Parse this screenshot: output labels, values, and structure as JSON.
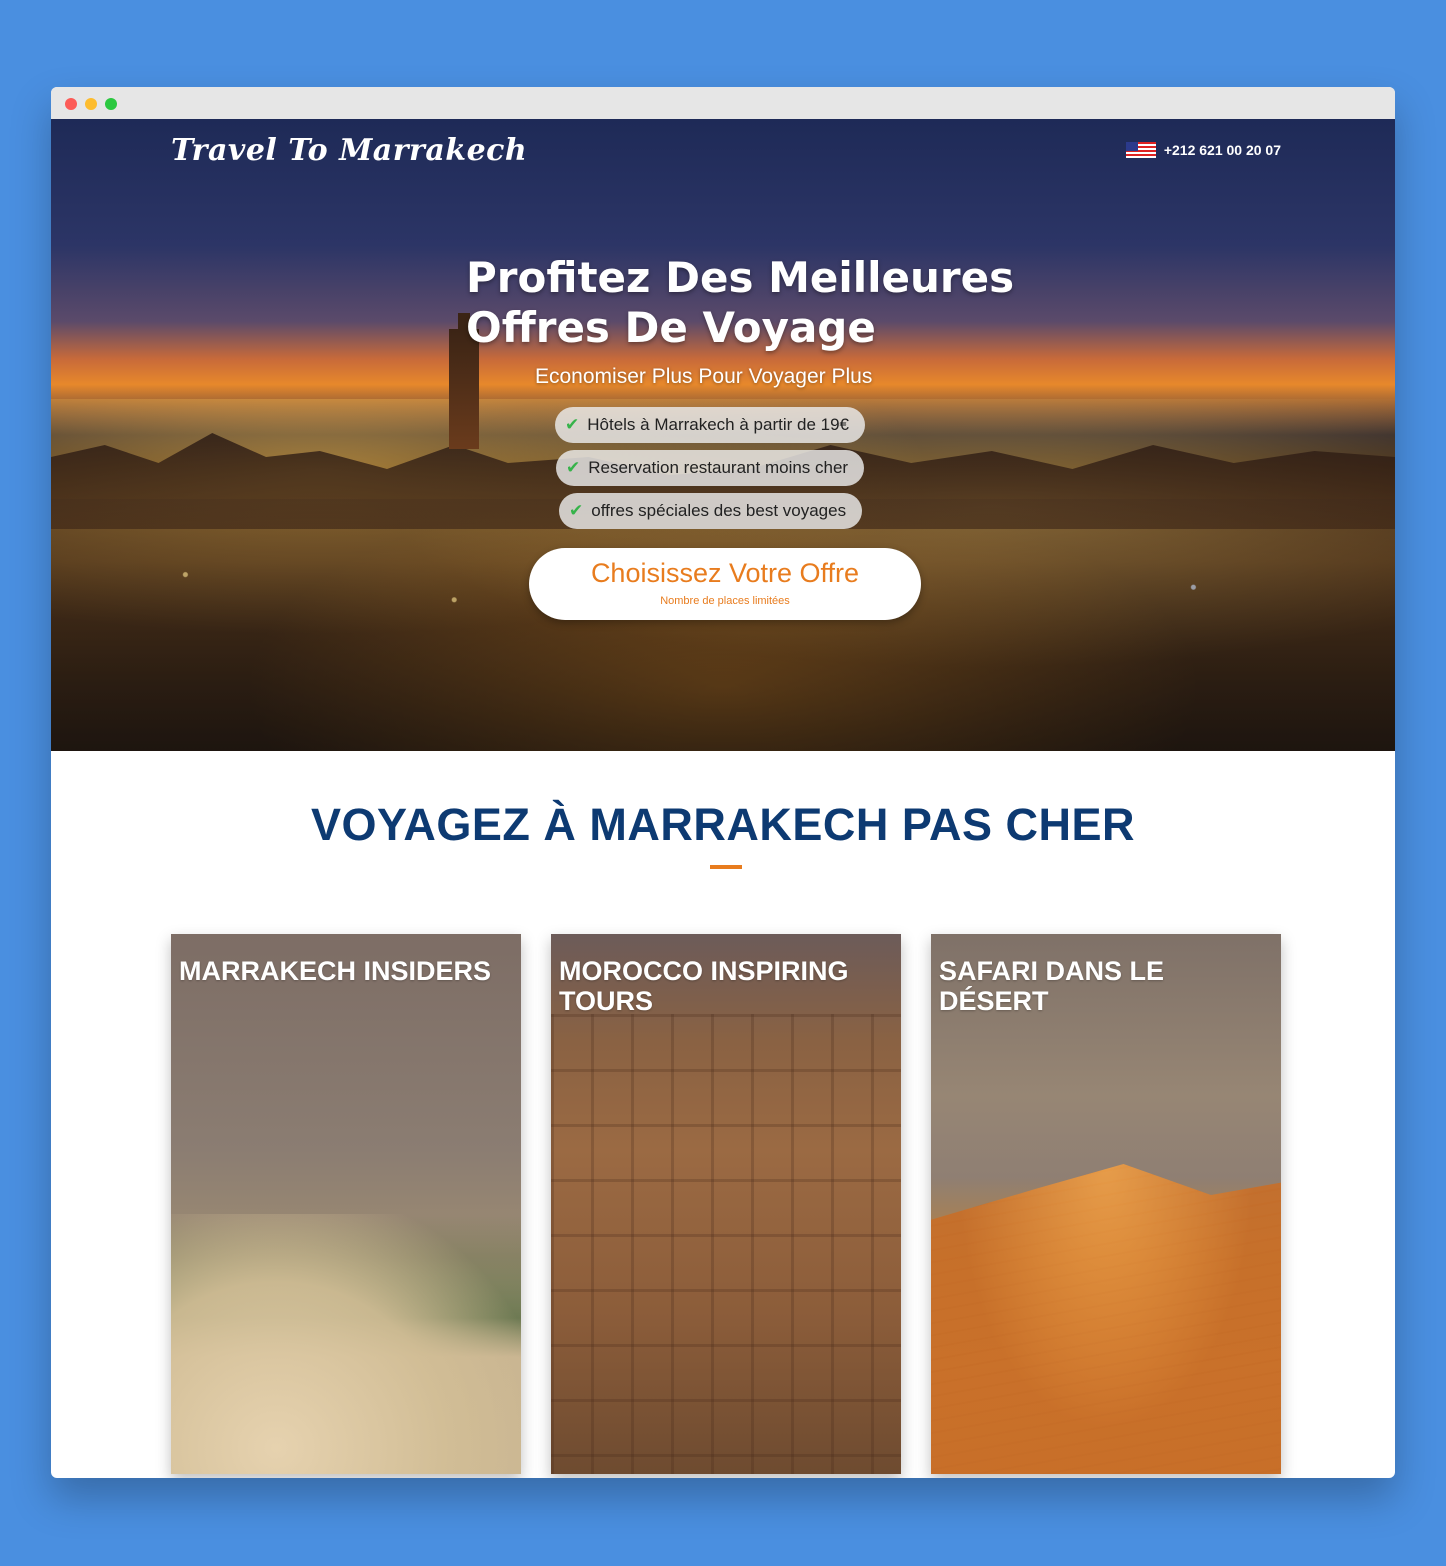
{
  "header": {
    "logo": "Travel To Marrakech",
    "phone": "+212 621 00 20 07"
  },
  "hero": {
    "title_line1": "Profitez Des Meilleures",
    "title_line2": "Offres De Voyage",
    "subtitle": "Economiser Plus Pour Voyager Plus",
    "features": [
      "Hôtels à Marrakech à partir de 19€",
      "Reservation restaurant moins cher",
      "offres spéciales des best voyages"
    ],
    "cta_label": "Choisissez Votre Offre",
    "cta_note": "Nombre de places limitées"
  },
  "section": {
    "title": "VOYAGEZ À MARRAKECH PAS CHER"
  },
  "cards": [
    {
      "title": "MARRAKECH INSIDERS"
    },
    {
      "title": "MOROCCO INSPIRING TOURS"
    },
    {
      "title": "SAFARI DANS LE DÉSERT"
    }
  ],
  "colors": {
    "accent": "#e87c1e",
    "heading": "#0d3a72",
    "background": "#4a8fe0"
  }
}
